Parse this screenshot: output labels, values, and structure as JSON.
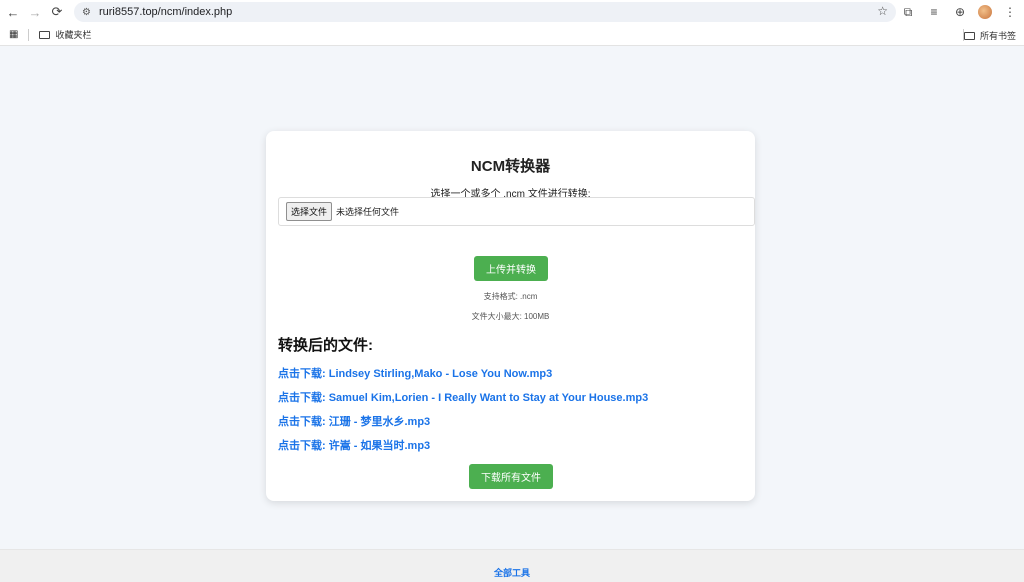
{
  "browser": {
    "url": "ruri8557.top/ncm/index.php",
    "bookmark_folder": "收藏夹栏",
    "all_bookmarks": "所有书签"
  },
  "card": {
    "title": "NCM转换器",
    "prompt": "选择一个或多个 .ncm 文件进行转换:",
    "file_button": "选择文件",
    "file_status": "未选择任何文件",
    "upload_button": "上传并转换",
    "format_info": "支持格式: .ncm",
    "size_info": "文件大小最大: 100MB",
    "results_title": "转换后的文件:",
    "downloads": [
      "点击下载: Lindsey Stirling,Mako - Lose You Now.mp3",
      "点击下载: Samuel Kim,Lorien - I Really Want to Stay at Your House.mp3",
      "点击下载: 江珊 - 梦里水乡.mp3",
      "点击下载: 许嵩 - 如果当时.mp3"
    ],
    "download_all_button": "下载所有文件"
  },
  "footer": {
    "link": "全部工具"
  },
  "colors": {
    "accent_green": "#4caf50",
    "link_blue": "#1a73e8"
  }
}
